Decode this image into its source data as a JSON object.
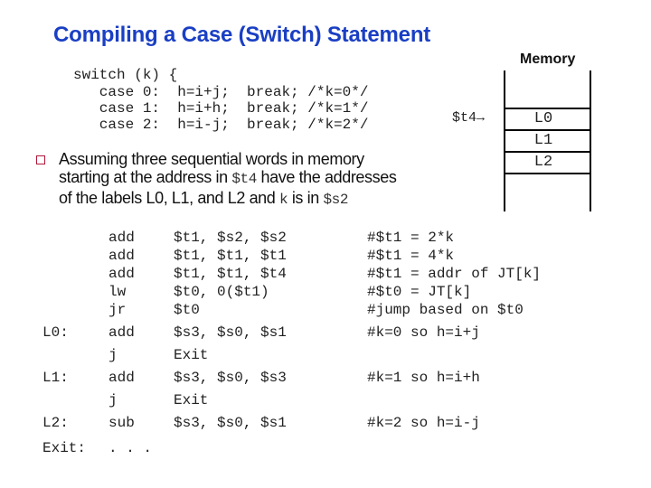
{
  "title": "Compiling a Case (Switch) Statement",
  "switch_code": [
    "switch (k) {",
    "   case 0:  h=i+j;  break; /*k=0*/",
    "   case 1:  h=i+h;  break; /*k=1*/",
    "   case 2:  h=i-j;  break; /*k=2*/"
  ],
  "memory": {
    "title": "Memory",
    "pointer_label": "$t4",
    "pointer_arrow": "→",
    "cells": [
      "L0",
      "L1",
      "L2"
    ]
  },
  "bullet": {
    "icon": "hollow-square-bullet",
    "line1": "Assuming three sequential words in memory",
    "line2_pre": "starting at the address in ",
    "line2_code": "$t4",
    "line2_post": " have the addresses",
    "line3_pre": "of the labels L0, L1, and L2 and ",
    "line3_code": "k",
    "line3_mid": " is in ",
    "line3_code2": "$s2"
  },
  "assembly": [
    {
      "label": "",
      "op": "add",
      "args": "$t1, $s2, $s2",
      "comment": "#$t1 = 2*k"
    },
    {
      "label": "",
      "op": "add",
      "args": "$t1, $t1, $t1",
      "comment": "#$t1 = 4*k"
    },
    {
      "label": "",
      "op": "add",
      "args": "$t1, $t1, $t4",
      "comment": "#$t1 = addr of JT[k]"
    },
    {
      "label": "",
      "op": "lw",
      "args": "$t0, 0($t1)",
      "comment": "#$t0 = JT[k]"
    },
    {
      "label": "",
      "op": "jr",
      "args": "$t0",
      "comment": "#jump based on $t0"
    },
    {
      "label": "L0:",
      "op": "add",
      "args": "$s3, $s0, $s1",
      "comment": "#k=0 so h=i+j"
    },
    {
      "label": "",
      "op": "j",
      "args": "Exit",
      "comment": ""
    },
    {
      "label": "L1:",
      "op": "add",
      "args": "$s3, $s0, $s3",
      "comment": "#k=1 so h=i+h"
    },
    {
      "label": "",
      "op": "j",
      "args": "Exit",
      "comment": ""
    },
    {
      "label": "L2:",
      "op": "sub",
      "args": "$s3, $s0, $s1",
      "comment": "#k=2 so h=i-j"
    },
    {
      "label": "Exit:",
      "op": ". . .",
      "args": "",
      "comment": ""
    }
  ],
  "colors": {
    "title": "#1a3fc4",
    "bullet": "#b0163a"
  }
}
